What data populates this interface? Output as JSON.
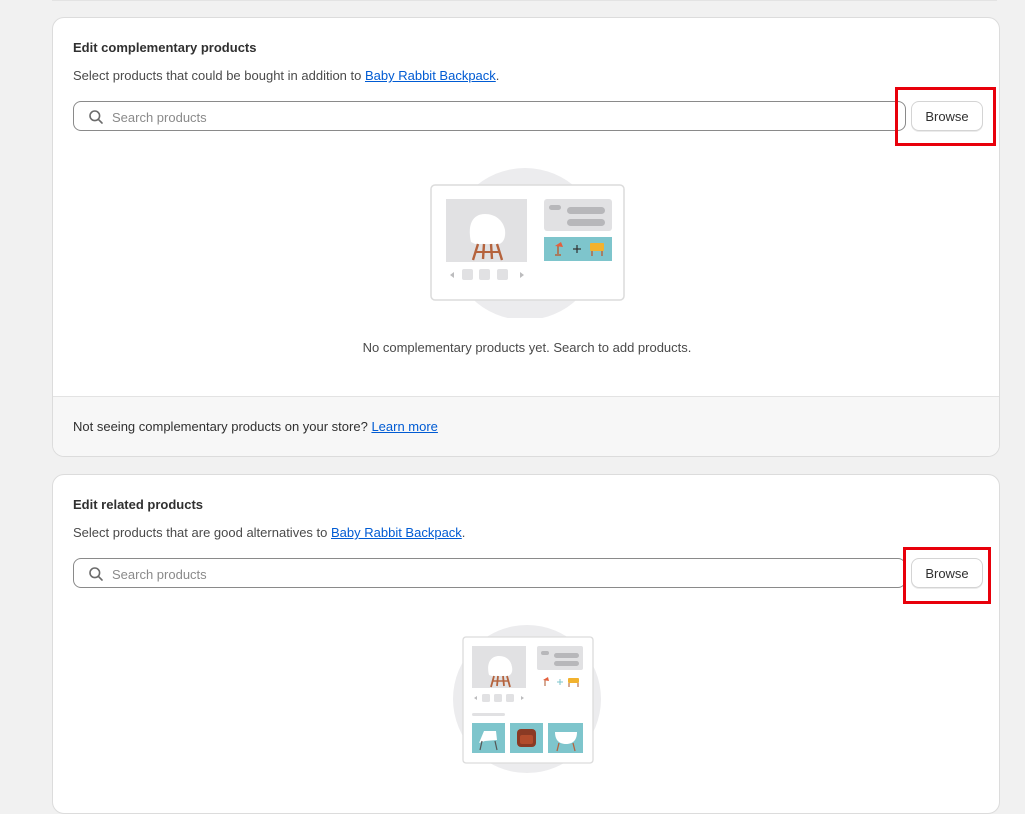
{
  "complementary": {
    "title": "Edit complementary products",
    "description_prefix": "Select products that could be bought in addition to ",
    "product_link": "Baby Rabbit Backpack",
    "description_suffix": ".",
    "search_placeholder": "Search products",
    "browse_label": "Browse",
    "empty_message": "No complementary products yet. Search to add products.",
    "footer_text": "Not seeing complementary products on your store? ",
    "footer_link": "Learn more"
  },
  "related": {
    "title": "Edit related products",
    "description_prefix": "Select products that are good alternatives to ",
    "product_link": "Baby Rabbit Backpack",
    "description_suffix": ".",
    "search_placeholder": "Search products",
    "browse_label": "Browse"
  },
  "icons": {
    "search": "search-icon",
    "illustration_complementary": "complementary-products-illustration",
    "illustration_related": "related-products-illustration"
  },
  "colors": {
    "link": "#005bd3",
    "highlight": "#e8000b",
    "teal": "#7ec5cc"
  }
}
